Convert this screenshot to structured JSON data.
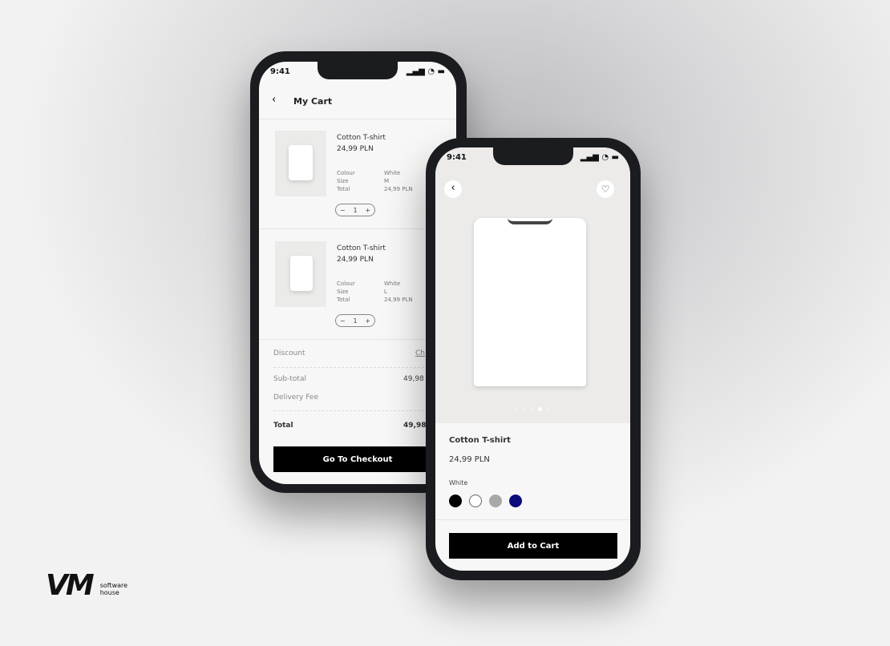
{
  "status_time": "9:41",
  "cart": {
    "title": "My Cart",
    "items": [
      {
        "name": "Cotton T-shirt",
        "price": "24,99 PLN",
        "colour_label": "Colour",
        "colour": "White",
        "size_label": "Size",
        "size": "M",
        "total_label": "Total",
        "total": "24,99 PLN",
        "qty": "1"
      },
      {
        "name": "Cotton T-shirt",
        "price": "24,99 PLN",
        "colour_label": "Colour",
        "colour": "White",
        "size_label": "Size",
        "size": "L",
        "total_label": "Total",
        "total": "24,99 PLN",
        "qty": "1"
      }
    ],
    "discount_label": "Discount",
    "discount_action": "Ch",
    "subtotal_label": "Sub-total",
    "subtotal": "49,98",
    "delivery_label": "Delivery Fee",
    "total_label": "Total",
    "total": "49,98",
    "checkout_label": "Go To Checkout"
  },
  "product": {
    "name": "Cotton T-shirt",
    "price": "24,99 PLN",
    "selected_colour": "White",
    "colours": [
      "#000000",
      "#ffffff",
      "#a8a8a8",
      "#0b0b7a"
    ],
    "image_dots": 5,
    "active_dot": 4,
    "add_label": "Add to Cart"
  },
  "logo": {
    "mark": "VM",
    "line1": "software",
    "line2": "house"
  }
}
